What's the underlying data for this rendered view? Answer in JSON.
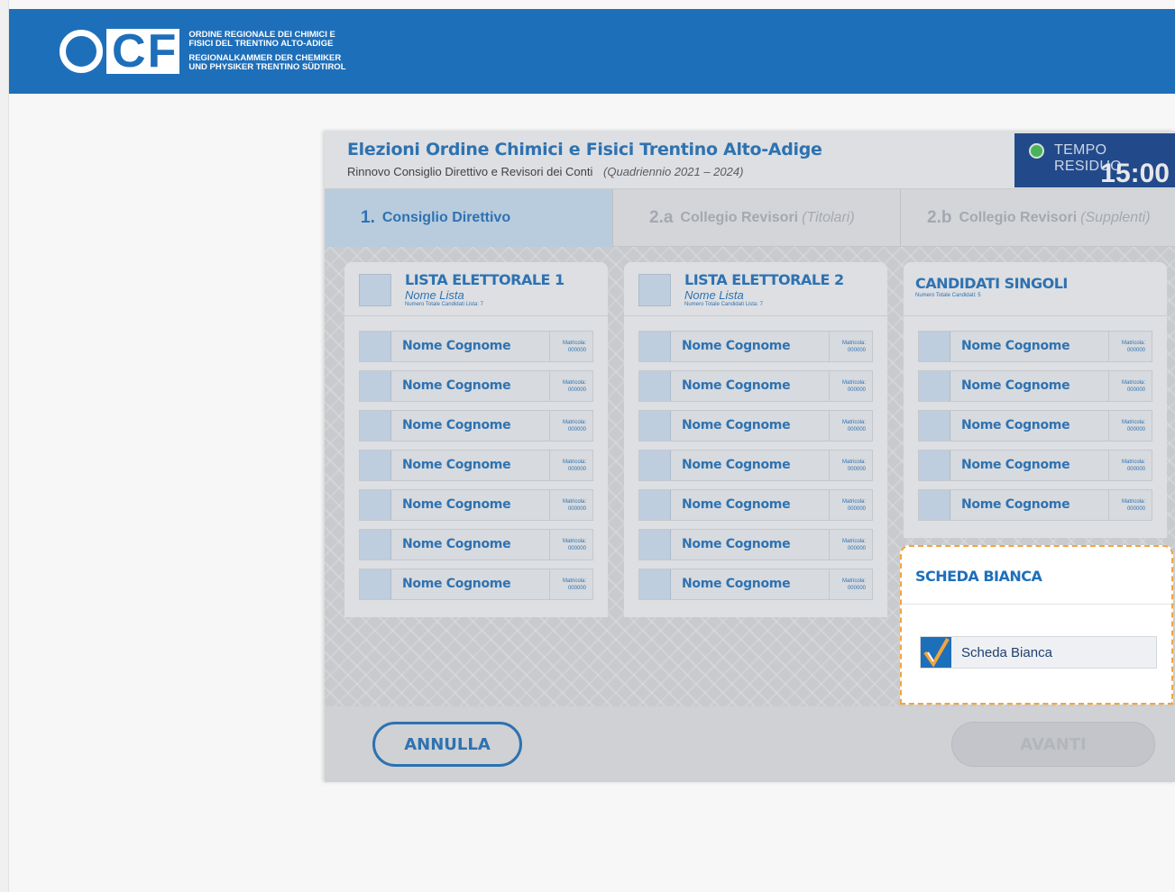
{
  "brand": {
    "logo_o": "O",
    "logo_c": "C",
    "logo_f": "F",
    "line1": "ORDINE REGIONALE DEI CHIMICI E",
    "line2": "FISICI DEL TRENTINO ALTO-ADIGE",
    "line3": "REGIONALKAMMER DER CHEMIKER",
    "line4": "UND PHYSIKER TRENTINO SÜDTIROL"
  },
  "election": {
    "title": "Elezioni Ordine Chimici e Fisici Trentino Alto-Adige",
    "subtitle": "Rinnovo Consiglio Direttivo e Revisori dei Conti",
    "period": "(Quadriennio 2021 – 2024)"
  },
  "timer": {
    "label": "TEMPO RESIDUO",
    "value": "15:00",
    "status_color": "#3fbf4f"
  },
  "tabs": [
    {
      "num": "1.",
      "label": "Consiglio Direttivo",
      "suffix": "",
      "active": true
    },
    {
      "num": "2.a",
      "label": "Collegio Revisori",
      "suffix": "(Titolari)",
      "active": false
    },
    {
      "num": "2.b",
      "label": "Collegio Revisori",
      "suffix": "(Supplenti)",
      "active": false
    }
  ],
  "lists": [
    {
      "title": "LISTA ELETTORALE 1",
      "subtitle": "Nome Lista",
      "count_label": "Numero Totale Candidati Lista: 7",
      "candidates": [
        {
          "name": "Nome Cognome",
          "mat_label": "Matricola:",
          "mat": "000000"
        },
        {
          "name": "Nome Cognome",
          "mat_label": "Matricola:",
          "mat": "000000"
        },
        {
          "name": "Nome Cognome",
          "mat_label": "Matricola:",
          "mat": "000000"
        },
        {
          "name": "Nome Cognome",
          "mat_label": "Matricola:",
          "mat": "000000"
        },
        {
          "name": "Nome Cognome",
          "mat_label": "Matricola:",
          "mat": "000000"
        },
        {
          "name": "Nome Cognome",
          "mat_label": "Matricola:",
          "mat": "000000"
        },
        {
          "name": "Nome Cognome",
          "mat_label": "Matricola:",
          "mat": "000000"
        }
      ]
    },
    {
      "title": "LISTA ELETTORALE 2",
      "subtitle": "Nome Lista",
      "count_label": "Numero Totale Candidati Lista: 7",
      "candidates": [
        {
          "name": "Nome Cognome",
          "mat_label": "Matricola:",
          "mat": "000000"
        },
        {
          "name": "Nome Cognome",
          "mat_label": "Matricola:",
          "mat": "000000"
        },
        {
          "name": "Nome Cognome",
          "mat_label": "Matricola:",
          "mat": "000000"
        },
        {
          "name": "Nome Cognome",
          "mat_label": "Matricola:",
          "mat": "000000"
        },
        {
          "name": "Nome Cognome",
          "mat_label": "Matricola:",
          "mat": "000000"
        },
        {
          "name": "Nome Cognome",
          "mat_label": "Matricola:",
          "mat": "000000"
        },
        {
          "name": "Nome Cognome",
          "mat_label": "Matricola:",
          "mat": "000000"
        }
      ]
    },
    {
      "title": "CANDIDATI SINGOLI",
      "count_label": "Numero Totale Candidati: 5",
      "candidates": [
        {
          "name": "Nome Cognome",
          "mat_label": "Matricola:",
          "mat": "000000"
        },
        {
          "name": "Nome Cognome",
          "mat_label": "Matricola:",
          "mat": "000000"
        },
        {
          "name": "Nome Cognome",
          "mat_label": "Matricola:",
          "mat": "000000"
        },
        {
          "name": "Nome Cognome",
          "mat_label": "Matricola:",
          "mat": "000000"
        },
        {
          "name": "Nome Cognome",
          "mat_label": "Matricola:",
          "mat": "000000"
        }
      ]
    }
  ],
  "blank_ballot": {
    "title": "SCHEDA BIANCA",
    "option_label": "Scheda Bianca",
    "checked": true,
    "highlight_color": "#f0a53d"
  },
  "actions": {
    "cancel_label": "ANNULLA",
    "next_label": "AVANTI",
    "next_enabled": false
  },
  "colors": {
    "brand_blue": "#1e6fba",
    "timer_bg": "#0f3f8c",
    "check_orange": "#f0a53d"
  }
}
